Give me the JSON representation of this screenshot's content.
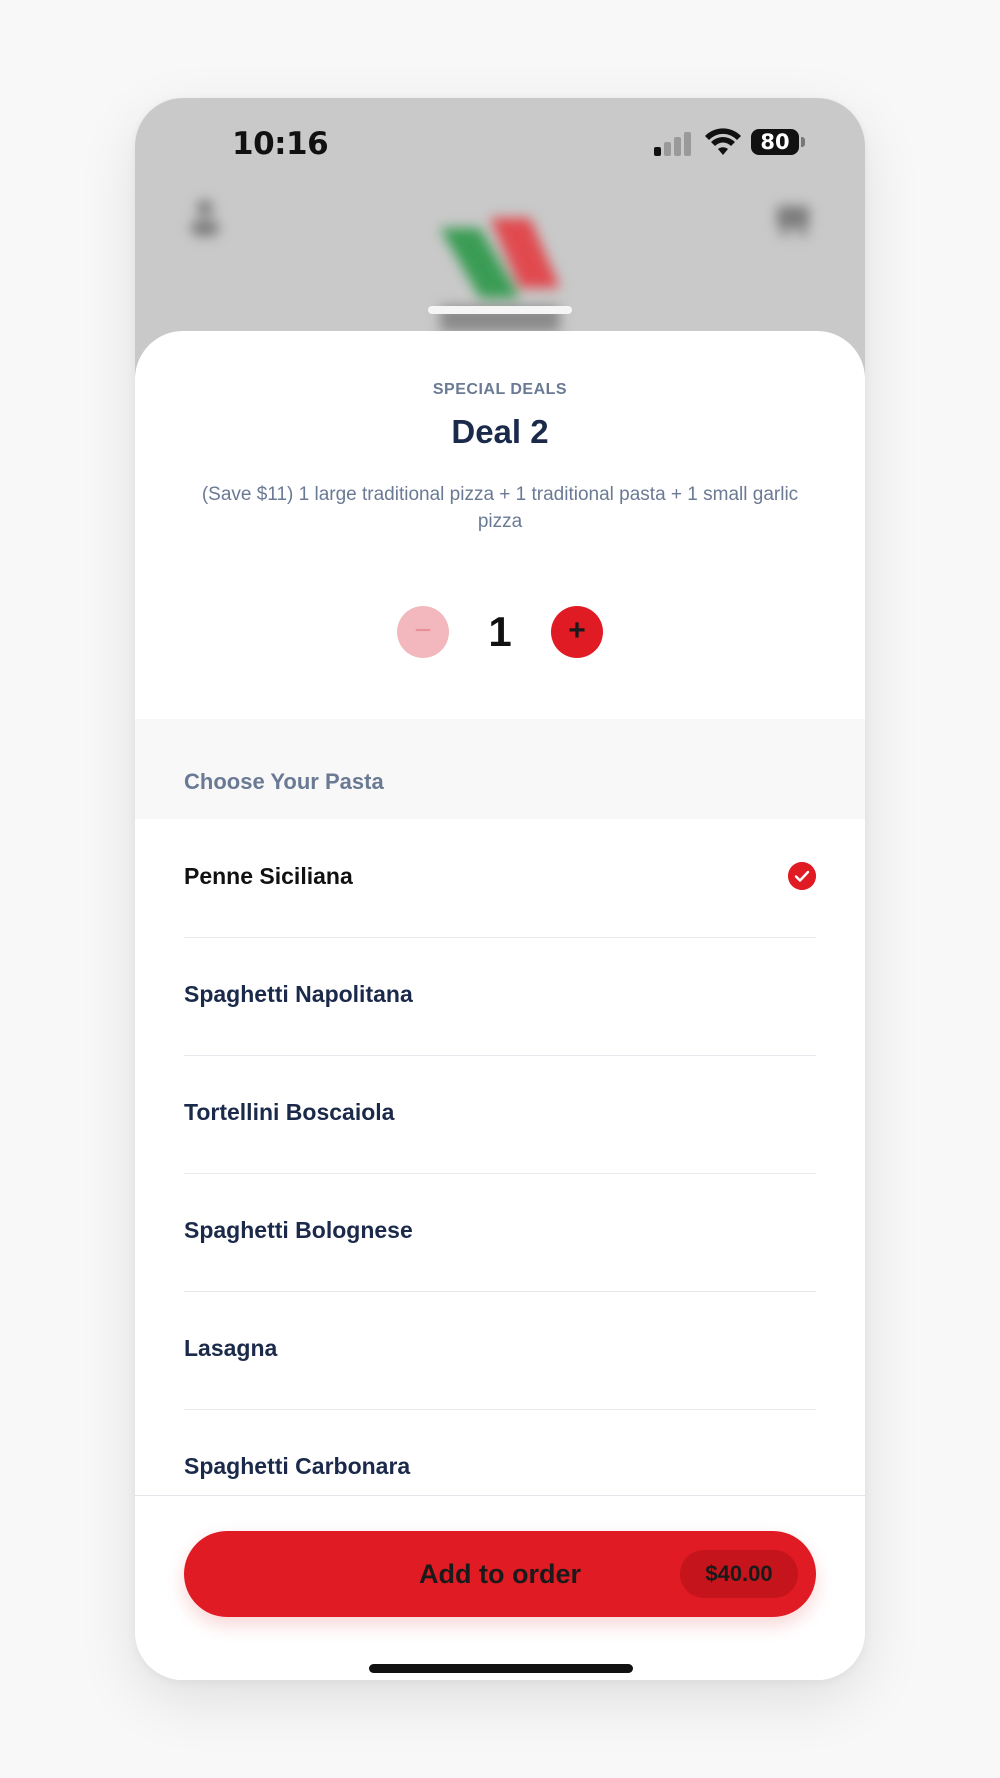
{
  "status_bar": {
    "time": "10:16",
    "battery": "80"
  },
  "header": {
    "eyebrow": "SPECIAL DEALS",
    "title": "Deal 2",
    "description": "(Save $11) 1 large traditional pizza + 1 traditional pasta + 1 small garlic pizza"
  },
  "quantity": {
    "minus_label": "−",
    "value": "1",
    "plus_label": "+"
  },
  "section": {
    "title": "Choose Your Pasta"
  },
  "options": [
    {
      "label": "Penne Siciliana",
      "selected": true
    },
    {
      "label": "Spaghetti Napolitana",
      "selected": false
    },
    {
      "label": "Tortellini Boscaiola",
      "selected": false
    },
    {
      "label": "Spaghetti Bolognese",
      "selected": false
    },
    {
      "label": "Lasagna",
      "selected": false
    },
    {
      "label": "Spaghetti Carbonara",
      "selected": false
    }
  ],
  "cta": {
    "label": "Add to order",
    "price": "$40.00"
  },
  "colors": {
    "accent": "#e01b24",
    "accent_dark": "#c5141c",
    "text_primary": "#1b2a4a",
    "text_muted": "#6b7a94"
  },
  "icons": {
    "check": "check-circle-icon",
    "account": "person-icon",
    "cart": "cart-icon",
    "logo": "brand-logo"
  }
}
